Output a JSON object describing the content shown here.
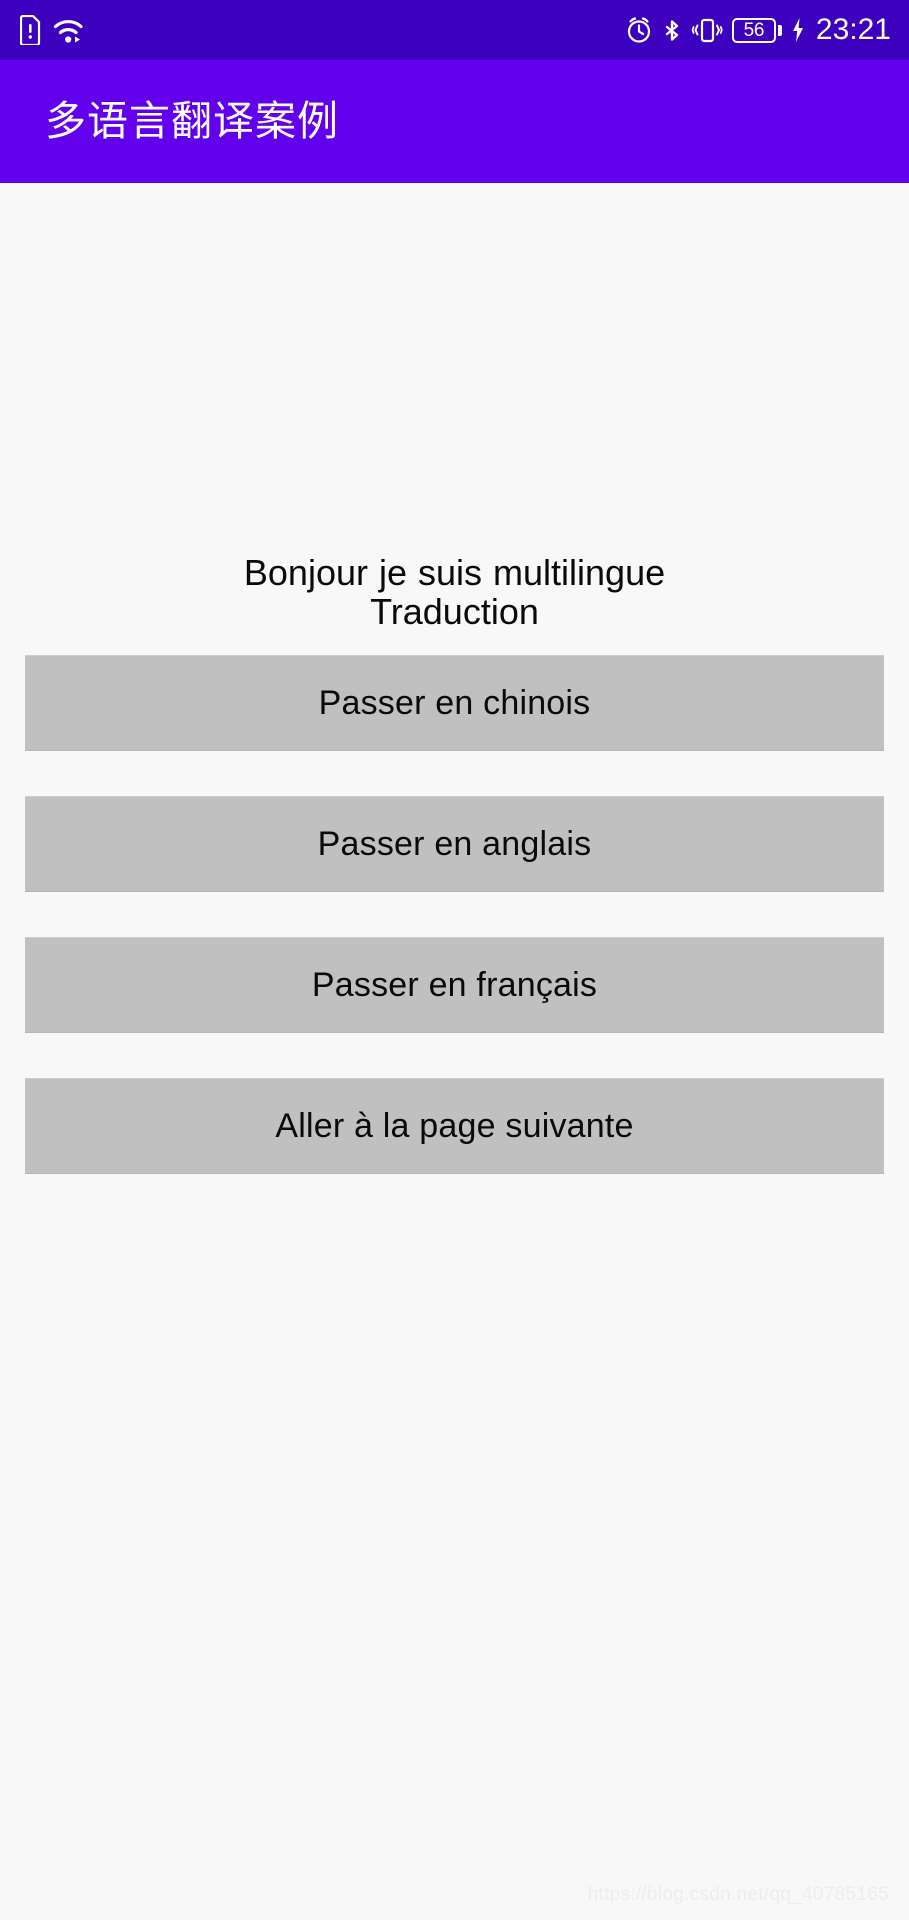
{
  "status_bar": {
    "background_color": "#3d00bf",
    "left_icons": [
      {
        "name": "sim-card-alert-icon",
        "label": "SIM card alert"
      },
      {
        "name": "wifi-data-icon",
        "label": "Wi-Fi with data transfer"
      }
    ],
    "right_icons": [
      {
        "name": "alarm-clock-icon",
        "label": "Alarm set"
      },
      {
        "name": "bluetooth-icon",
        "label": "Bluetooth on"
      },
      {
        "name": "vibrate-icon",
        "label": "Vibrate mode"
      }
    ],
    "battery": {
      "level_text": "56",
      "charging_icon": "charging-bolt-icon"
    },
    "time": "23:21"
  },
  "app_bar": {
    "title": "多语言翻译案例",
    "background_color": "#6200ee",
    "text_color": "#ffffff"
  },
  "main": {
    "background_color": "#f8f8f8",
    "greeting_text": "Bonjour je suis multilingue Traduction",
    "greeting_lines": [
      "Bonjour",
      "je suis",
      "multilingue",
      "Traduction"
    ],
    "buttons": [
      {
        "id": "switch-to-chinese",
        "label": "Passer en chinois"
      },
      {
        "id": "switch-to-english",
        "label": "Passer en anglais"
      },
      {
        "id": "switch-to-french",
        "label": "Passer en français"
      },
      {
        "id": "go-to-next-page",
        "label": "Aller à la page suivante"
      }
    ],
    "button_color": "#c0c0c0",
    "button_text_color": "#0a0a0a"
  },
  "watermark": {
    "text": "https://blog.csdn.net/qq_40785165"
  }
}
